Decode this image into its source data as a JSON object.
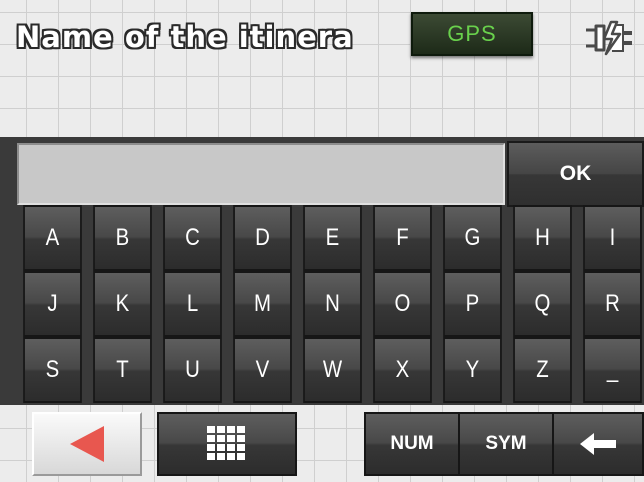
{
  "header": {
    "title": "Name of the itinera",
    "gps_label": "GPS",
    "power_icon": "power-plug-icon"
  },
  "input": {
    "value": "",
    "placeholder": ""
  },
  "keyboard": {
    "ok_label": "OK",
    "rows": [
      [
        "A",
        "B",
        "C",
        "D",
        "E",
        "F",
        "G",
        "H",
        "I"
      ],
      [
        "J",
        "K",
        "L",
        "M",
        "N",
        "O",
        "P",
        "Q",
        "R"
      ],
      [
        "S",
        "T",
        "U",
        "V",
        "W",
        "X",
        "Y",
        "Z",
        "_"
      ]
    ]
  },
  "toolbar": {
    "back_icon": "back-arrow-icon",
    "grid_icon": "keyboard-grid-icon",
    "num_label": "NUM",
    "sym_label": "SYM",
    "backspace_icon": "backspace-arrow-icon"
  },
  "colors": {
    "back_arrow": "#e8574f",
    "gps_text": "#69d14c",
    "key_background": "#3a3a3a",
    "page_background": "#ececec"
  }
}
